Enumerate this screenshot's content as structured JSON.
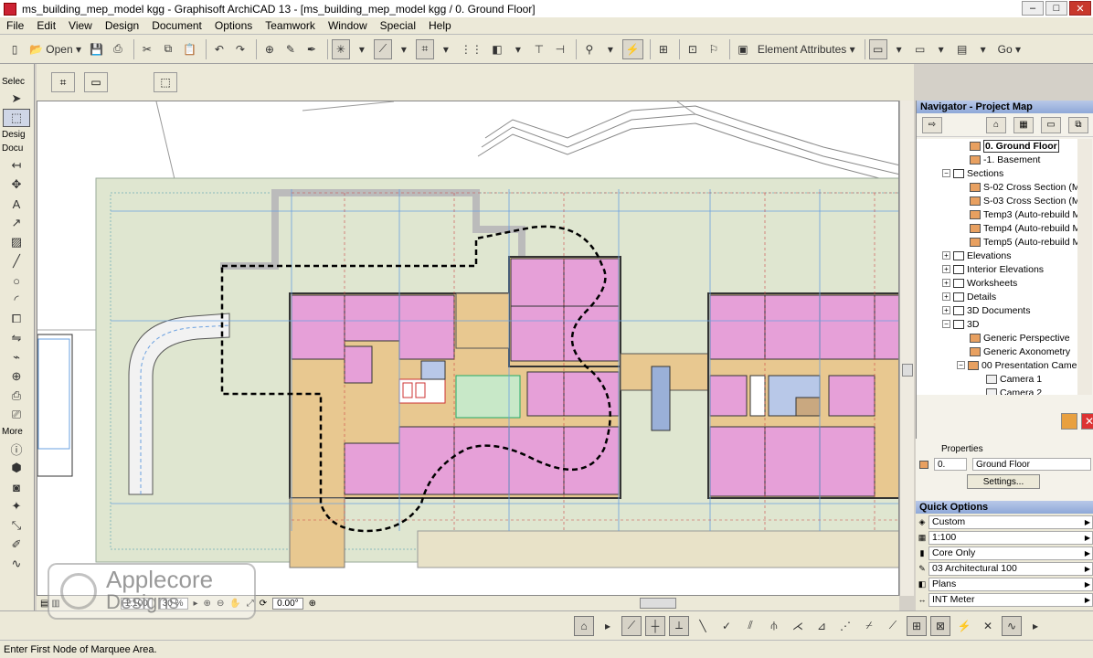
{
  "window": {
    "title": "ms_building_mep_model kgg - Graphisoft ArchiCAD 13 - [ms_building_mep_model kgg / 0. Ground Floor]",
    "min": "–",
    "max": "□",
    "close": "✕"
  },
  "menu": [
    "File",
    "Edit",
    "View",
    "Design",
    "Document",
    "Options",
    "Teamwork",
    "Window",
    "Special",
    "Help"
  ],
  "toolbar": {
    "open_label": "Open",
    "element_attributes": "Element Attributes",
    "go_label": "Go"
  },
  "toolbox": {
    "select_group": "Selec",
    "design_group": "Desig",
    "document_group": "Docu",
    "more_group": "More"
  },
  "view_status": {
    "scale": "1:100",
    "zoom": "30 %",
    "angle": "0.00°"
  },
  "navigator": {
    "title": "Navigator - Project Map",
    "items": [
      {
        "label": "0. Ground Floor",
        "selected": true
      },
      {
        "label": "-1. Basement"
      },
      {
        "label": "Sections"
      },
      {
        "label": "S-02 Cross Section (M"
      },
      {
        "label": "S-03 Cross Section (M"
      },
      {
        "label": "Temp3 (Auto-rebuild M"
      },
      {
        "label": "Temp4 (Auto-rebuild M"
      },
      {
        "label": "Temp5 (Auto-rebuild M"
      },
      {
        "label": "Elevations"
      },
      {
        "label": "Interior Elevations"
      },
      {
        "label": "Worksheets"
      },
      {
        "label": "Details"
      },
      {
        "label": "3D Documents"
      },
      {
        "label": "3D"
      },
      {
        "label": "Generic Perspective"
      },
      {
        "label": "Generic Axonometry"
      },
      {
        "label": "00 Presentation Came"
      },
      {
        "label": "Camera 1"
      },
      {
        "label": "Camera 2"
      }
    ]
  },
  "properties": {
    "header": "Properties",
    "story_index": "0.",
    "story_name": "Ground Floor",
    "settings_button": "Settings..."
  },
  "quick_options": {
    "title": "Quick Options",
    "rows": [
      "Custom",
      "1:100",
      "Core Only",
      "03 Architectural 100",
      "Plans",
      "INT Meter"
    ]
  },
  "status_bar": "Enter First Node of Marquee Area.",
  "watermark": {
    "line1": "Applecore",
    "line2": "Designs"
  },
  "colors": {
    "room_fill": "#e6a0d8",
    "corridor_fill": "#e8c890",
    "site_fill": "#dfe6d0",
    "grid_line": "#6aa0e0"
  }
}
